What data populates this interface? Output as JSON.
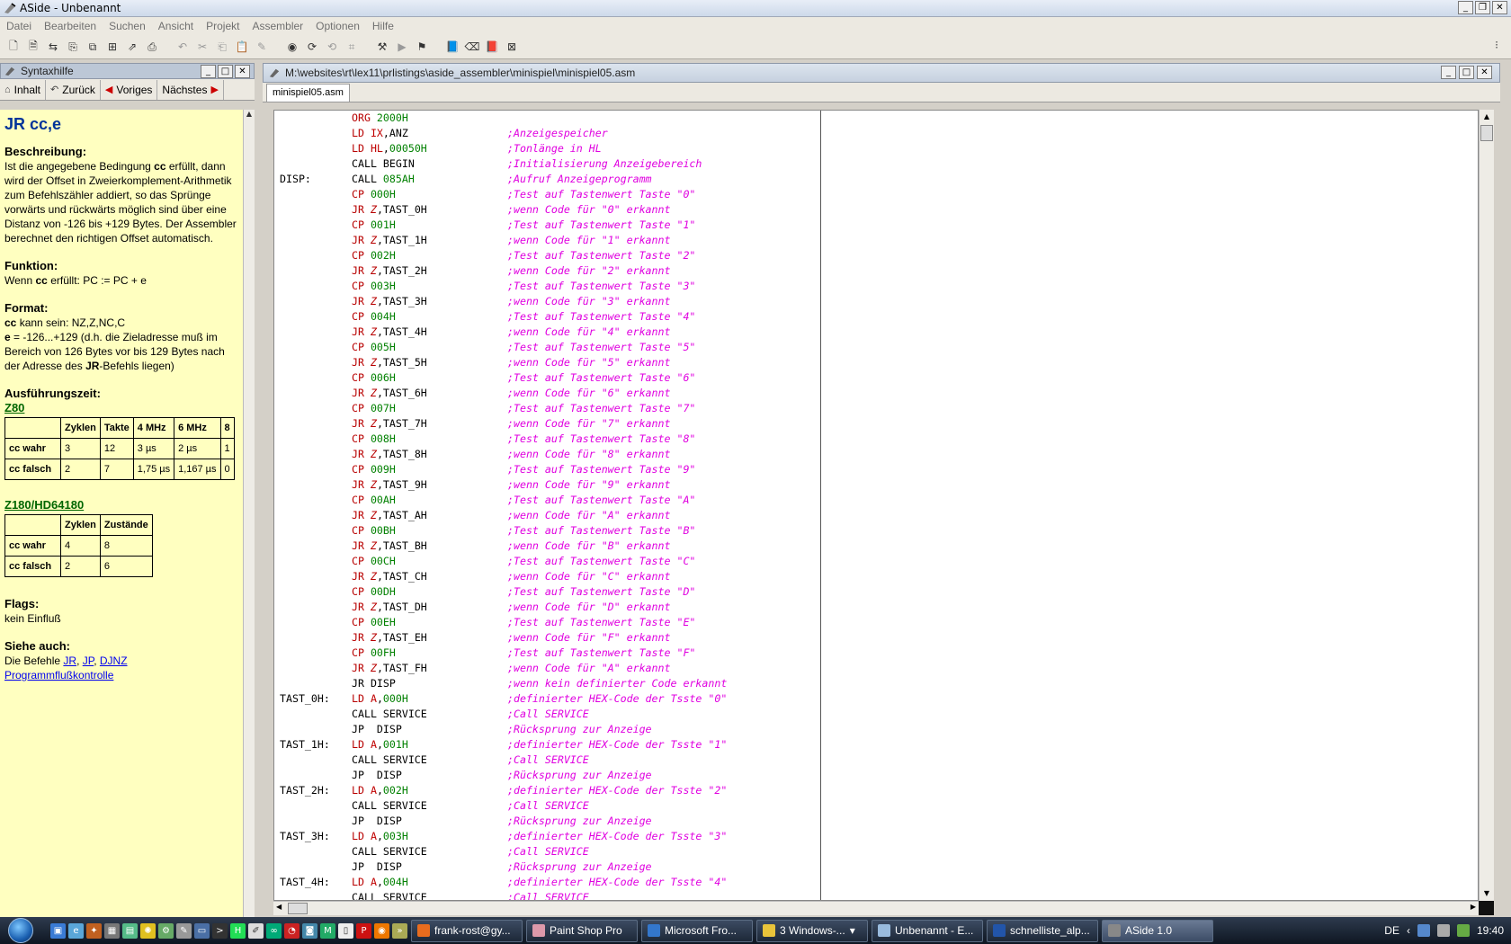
{
  "window": {
    "title": "ASide - Unbenannt"
  },
  "menu": [
    "Datei",
    "Bearbeiten",
    "Suchen",
    "Ansicht",
    "Projekt",
    "Assembler",
    "Optionen",
    "Hilfe"
  ],
  "help_panel": {
    "title": "Syntaxhilfe",
    "nav": {
      "contents": "Inhalt",
      "back": "Zurück",
      "prev": "Voriges",
      "next": "Nächstes"
    },
    "heading": "JR cc,e",
    "desc_label": "Beschreibung",
    "desc_1": "Ist die angegebene Bedingung",
    "desc_cc": "cc",
    "desc_2": "erfüllt, dann wird der Offset in Zweierkomplement-Arithmetik zum Befehlszähler addiert, so das Sprünge vorwärts und rückwärts möglich sind über eine Distanz von -126 bis +129 Bytes. Der Assembler berechnet den richtigen Offset automatisch.",
    "func_label": "Funktion",
    "func_1": "Wenn",
    "func_cc": "cc",
    "func_2": "erfüllt: PC := PC + e",
    "format_label": "Format",
    "format_cc": "cc",
    "format_1": "kann sein: NZ,Z,NC,C",
    "format_e": "e",
    "format_2": "= -126...+129 (d.h. die Zieladresse muß im Bereich von 126 Bytes vor bis 129 Bytes nach der Adresse des",
    "format_jr": "JR",
    "format_3": "-Befehls liegen)",
    "time_label": "Ausführungszeit",
    "z80_label": "Z80",
    "z80_headers": [
      "",
      "Zyklen",
      "Takte",
      "4 MHz",
      "6 MHz",
      "8"
    ],
    "z80_rows": [
      [
        "cc wahr",
        "3",
        "12",
        "3 µs",
        "2 µs",
        "1"
      ],
      [
        "cc falsch",
        "2",
        "7",
        "1,75 µs",
        "1,167 µs",
        "0"
      ]
    ],
    "z180_label": "Z180/HD64180",
    "z180_headers": [
      "",
      "Zyklen",
      "Zustände"
    ],
    "z180_rows": [
      [
        "cc wahr",
        "4",
        "8"
      ],
      [
        "cc falsch",
        "2",
        "6"
      ]
    ],
    "flags_label": "Flags",
    "flags_text": "kein Einfluß",
    "see_label": "Siehe auch",
    "see_text": "Die Befehle",
    "see_links": [
      "JR",
      "JP",
      "DJNZ"
    ],
    "see_link2": "Programmflußkontrolle"
  },
  "editor": {
    "title": "M:\\websites\\rt\\lex11\\prlistings\\aside_assembler\\minispiel\\minispiel05.asm",
    "tab": "minispiel05.asm",
    "lines": [
      {
        "label": "",
        "mn": "ORG",
        "ops": [
          [
            "num",
            "2000H"
          ]
        ],
        "comment": ""
      },
      {
        "label": "",
        "mn": "LD",
        "ops": [
          [
            "reg",
            "IX"
          ],
          [
            "op",
            ",ANZ"
          ]
        ],
        "comment": ";Anzeigespeicher"
      },
      {
        "label": "",
        "mn": "LD",
        "ops": [
          [
            "reg",
            "HL"
          ],
          [
            "op",
            ","
          ],
          [
            "num",
            "00050H"
          ]
        ],
        "comment": ";Tonlänge in HL"
      },
      {
        "label": "",
        "mn": "CALL",
        "ops": [
          [
            "op",
            "BEGIN"
          ]
        ],
        "comment": ";Initialisierung Anzeigebereich"
      },
      {
        "label": "DISP:",
        "mn": "CALL",
        "ops": [
          [
            "num",
            "085AH"
          ]
        ],
        "comment": ";Aufruf Anzeigeprogramm"
      },
      {
        "label": "",
        "mn": "CP",
        "ops": [
          [
            "num",
            "000H"
          ]
        ],
        "comment": ";Test auf Tastenwert Taste \"0\""
      },
      {
        "label": "",
        "mn": "JR",
        "ops": [
          [
            "fl",
            "Z"
          ],
          [
            "op",
            ",TAST_0H"
          ]
        ],
        "comment": ";wenn Code für \"0\" erkannt"
      },
      {
        "label": "",
        "mn": "CP",
        "ops": [
          [
            "num",
            "001H"
          ]
        ],
        "comment": ";Test auf Tastenwert Taste \"1\""
      },
      {
        "label": "",
        "mn": "JR",
        "ops": [
          [
            "fl",
            "Z"
          ],
          [
            "op",
            ",TAST_1H"
          ]
        ],
        "comment": ";wenn Code für \"1\" erkannt"
      },
      {
        "label": "",
        "mn": "CP",
        "ops": [
          [
            "num",
            "002H"
          ]
        ],
        "comment": ";Test auf Tastenwert Taste \"2\""
      },
      {
        "label": "",
        "mn": "JR",
        "ops": [
          [
            "fl",
            "Z"
          ],
          [
            "op",
            ",TAST_2H"
          ]
        ],
        "comment": ";wenn Code für \"2\" erkannt"
      },
      {
        "label": "",
        "mn": "CP",
        "ops": [
          [
            "num",
            "003H"
          ]
        ],
        "comment": ";Test auf Tastenwert Taste \"3\""
      },
      {
        "label": "",
        "mn": "JR",
        "ops": [
          [
            "fl",
            "Z"
          ],
          [
            "op",
            ",TAST_3H"
          ]
        ],
        "comment": ";wenn Code für \"3\" erkannt"
      },
      {
        "label": "",
        "mn": "CP",
        "ops": [
          [
            "num",
            "004H"
          ]
        ],
        "comment": ";Test auf Tastenwert Taste \"4\""
      },
      {
        "label": "",
        "mn": "JR",
        "ops": [
          [
            "fl",
            "Z"
          ],
          [
            "op",
            ",TAST_4H"
          ]
        ],
        "comment": ";wenn Code für \"4\" erkannt"
      },
      {
        "label": "",
        "mn": "CP",
        "ops": [
          [
            "num",
            "005H"
          ]
        ],
        "comment": ";Test auf Tastenwert Taste \"5\""
      },
      {
        "label": "",
        "mn": "JR",
        "ops": [
          [
            "fl",
            "Z"
          ],
          [
            "op",
            ",TAST_5H"
          ]
        ],
        "comment": ";wenn Code für \"5\" erkannt"
      },
      {
        "label": "",
        "mn": "CP",
        "ops": [
          [
            "num",
            "006H"
          ]
        ],
        "comment": ";Test auf Tastenwert Taste \"6\""
      },
      {
        "label": "",
        "mn": "JR",
        "ops": [
          [
            "fl",
            "Z"
          ],
          [
            "op",
            ",TAST_6H"
          ]
        ],
        "comment": ";wenn Code für \"6\" erkannt"
      },
      {
        "label": "",
        "mn": "CP",
        "ops": [
          [
            "num",
            "007H"
          ]
        ],
        "comment": ";Test auf Tastenwert Taste \"7\""
      },
      {
        "label": "",
        "mn": "JR",
        "ops": [
          [
            "fl",
            "Z"
          ],
          [
            "op",
            ",TAST_7H"
          ]
        ],
        "comment": ";wenn Code für \"7\" erkannt"
      },
      {
        "label": "",
        "mn": "CP",
        "ops": [
          [
            "num",
            "008H"
          ]
        ],
        "comment": ";Test auf Tastenwert Taste \"8\""
      },
      {
        "label": "",
        "mn": "JR",
        "ops": [
          [
            "fl",
            "Z"
          ],
          [
            "op",
            ",TAST_8H"
          ]
        ],
        "comment": ";wenn Code für \"8\" erkannt"
      },
      {
        "label": "",
        "mn": "CP",
        "ops": [
          [
            "num",
            "009H"
          ]
        ],
        "comment": ";Test auf Tastenwert Taste \"9\""
      },
      {
        "label": "",
        "mn": "JR",
        "ops": [
          [
            "fl",
            "Z"
          ],
          [
            "op",
            ",TAST_9H"
          ]
        ],
        "comment": ";wenn Code für \"9\" erkannt"
      },
      {
        "label": "",
        "mn": "CP",
        "ops": [
          [
            "num",
            "00AH"
          ]
        ],
        "comment": ";Test auf Tastenwert Taste \"A\""
      },
      {
        "label": "",
        "mn": "JR",
        "ops": [
          [
            "fl",
            "Z"
          ],
          [
            "op",
            ",TAST_AH"
          ]
        ],
        "comment": ";wenn Code für \"A\" erkannt"
      },
      {
        "label": "",
        "mn": "CP",
        "ops": [
          [
            "num",
            "00BH"
          ]
        ],
        "comment": ";Test auf Tastenwert Taste \"B\""
      },
      {
        "label": "",
        "mn": "JR",
        "ops": [
          [
            "fl",
            "Z"
          ],
          [
            "op",
            ",TAST_BH"
          ]
        ],
        "comment": ";wenn Code für \"B\" erkannt"
      },
      {
        "label": "",
        "mn": "CP",
        "ops": [
          [
            "num",
            "00CH"
          ]
        ],
        "comment": ";Test auf Tastenwert Taste \"C\""
      },
      {
        "label": "",
        "mn": "JR",
        "ops": [
          [
            "fl",
            "Z"
          ],
          [
            "op",
            ",TAST_CH"
          ]
        ],
        "comment": ";wenn Code für \"C\" erkannt"
      },
      {
        "label": "",
        "mn": "CP",
        "ops": [
          [
            "num",
            "00DH"
          ]
        ],
        "comment": ";Test auf Tastenwert Taste \"D\""
      },
      {
        "label": "",
        "mn": "JR",
        "ops": [
          [
            "fl",
            "Z"
          ],
          [
            "op",
            ",TAST_DH"
          ]
        ],
        "comment": ";wenn Code für \"D\" erkannt"
      },
      {
        "label": "",
        "mn": "CP",
        "ops": [
          [
            "num",
            "00EH"
          ]
        ],
        "comment": ";Test auf Tastenwert Taste \"E\""
      },
      {
        "label": "",
        "mn": "JR",
        "ops": [
          [
            "fl",
            "Z"
          ],
          [
            "op",
            ",TAST_EH"
          ]
        ],
        "comment": ";wenn Code für \"F\" erkannt"
      },
      {
        "label": "",
        "mn": "CP",
        "ops": [
          [
            "num",
            "00FH"
          ]
        ],
        "comment": ";Test auf Tastenwert Taste \"F\""
      },
      {
        "label": "",
        "mn": "JR",
        "ops": [
          [
            "fl",
            "Z"
          ],
          [
            "op",
            ",TAST_FH"
          ]
        ],
        "comment": ";wenn Code für \"A\" erkannt"
      },
      {
        "label": "",
        "mn": "JR",
        "ops": [
          [
            "op",
            "DISP"
          ]
        ],
        "comment": ";wenn kein definierter Code erkannt"
      },
      {
        "label": "TAST_0H:",
        "mn": "LD",
        "ops": [
          [
            "reg",
            "A"
          ],
          [
            "op",
            ","
          ],
          [
            "num",
            "000H"
          ]
        ],
        "comment": ";definierter HEX-Code der Tsste \"0\""
      },
      {
        "label": "",
        "mn": "CALL",
        "ops": [
          [
            "op",
            "SERVICE"
          ]
        ],
        "comment": ";Call SERVICE"
      },
      {
        "label": "",
        "mn": "JP",
        "ops": [
          [
            "op",
            " DISP"
          ]
        ],
        "comment": ";Rücksprung zur Anzeige"
      },
      {
        "label": "TAST_1H:",
        "mn": "LD",
        "ops": [
          [
            "reg",
            "A"
          ],
          [
            "op",
            ","
          ],
          [
            "num",
            "001H"
          ]
        ],
        "comment": ";definierter HEX-Code der Tsste \"1\""
      },
      {
        "label": "",
        "mn": "CALL",
        "ops": [
          [
            "op",
            "SERVICE"
          ]
        ],
        "comment": ";Call SERVICE"
      },
      {
        "label": "",
        "mn": "JP",
        "ops": [
          [
            "op",
            " DISP"
          ]
        ],
        "comment": ";Rücksprung zur Anzeige"
      },
      {
        "label": "TAST_2H:",
        "mn": "LD",
        "ops": [
          [
            "reg",
            "A"
          ],
          [
            "op",
            ","
          ],
          [
            "num",
            "002H"
          ]
        ],
        "comment": ";definierter HEX-Code der Tsste \"2\""
      },
      {
        "label": "",
        "mn": "CALL",
        "ops": [
          [
            "op",
            "SERVICE"
          ]
        ],
        "comment": ";Call SERVICE"
      },
      {
        "label": "",
        "mn": "JP",
        "ops": [
          [
            "op",
            " DISP"
          ]
        ],
        "comment": ";Rücksprung zur Anzeige"
      },
      {
        "label": "TAST_3H:",
        "mn": "LD",
        "ops": [
          [
            "reg",
            "A"
          ],
          [
            "op",
            ","
          ],
          [
            "num",
            "003H"
          ]
        ],
        "comment": ";definierter HEX-Code der Tsste \"3\""
      },
      {
        "label": "",
        "mn": "CALL",
        "ops": [
          [
            "op",
            "SERVICE"
          ]
        ],
        "comment": ";Call SERVICE"
      },
      {
        "label": "",
        "mn": "JP",
        "ops": [
          [
            "op",
            " DISP"
          ]
        ],
        "comment": ";Rücksprung zur Anzeige"
      },
      {
        "label": "TAST_4H:",
        "mn": "LD",
        "ops": [
          [
            "reg",
            "A"
          ],
          [
            "op",
            ","
          ],
          [
            "num",
            "004H"
          ]
        ],
        "comment": ";definierter HEX-Code der Tsste \"4\""
      },
      {
        "label": "",
        "mn": "CALL",
        "ops": [
          [
            "op",
            "SERVICE"
          ]
        ],
        "comment": ";Call SERVICE"
      }
    ]
  },
  "taskbar": {
    "tasks": [
      "frank-rost@gy...",
      "Paint Shop Pro",
      "Microsoft Fro...",
      "3 Windows-...",
      "Unbenannt - E...",
      "schnelliste_alp...",
      "ASide 1.0"
    ],
    "lang": "DE",
    "clock": "19:40"
  }
}
